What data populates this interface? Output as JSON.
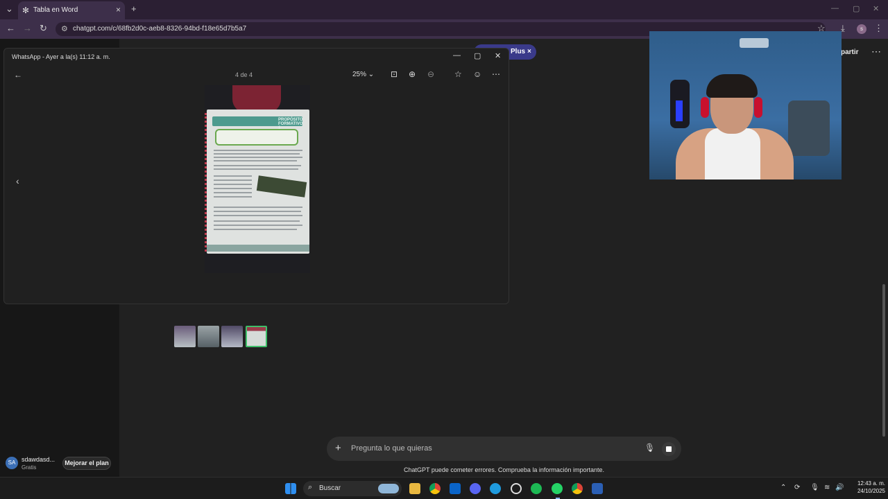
{
  "browser": {
    "tab_title": "Tabla en Word",
    "url": "chatgpt.com/c/68fb2d0c-aeb8-8326-94bd-f18e65d7b5a7"
  },
  "chatgpt": {
    "badge": "Plus",
    "share": "partir",
    "user_initials": "SA",
    "user_name": "sdawdasd...",
    "user_plan": "Gratis",
    "upgrade": "Mejorar el plan",
    "composer_placeholder": "Pregunta lo que quieras",
    "disclaimer": "ChatGPT puede cometer errores. Comprueba la información importante."
  },
  "whatsapp_viewer": {
    "title": "WhatsApp - Ayer a la(s) 11:12 a. m.",
    "counter": "4 de 4",
    "zoom": "25%",
    "photo_header": "PROPÓSITO FORMATIVO 1",
    "thumbnails": 4,
    "selected_thumbnail": 4
  },
  "taskbar": {
    "search": "Buscar",
    "time": "12:43 a. m.",
    "date": "24/10/2025"
  },
  "colors": {
    "browser_dark": "#2b1f33",
    "browser_bar": "#3d2f4a",
    "page_bg": "#212121",
    "accent_green": "#3fbf6a"
  }
}
